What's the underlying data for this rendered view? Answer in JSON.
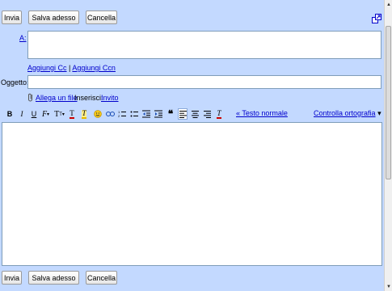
{
  "top_bar": {
    "send": "Invia",
    "save": "Salva adesso",
    "discard": "Cancella"
  },
  "bottom_bar": {
    "send": "Invia",
    "save": "Salva adesso",
    "discard": "Cancella"
  },
  "to": {
    "label": "A:",
    "value": ""
  },
  "recipients_links": {
    "add_cc": "Aggiungi Cc",
    "separator": "|",
    "add_bcc": "Aggiungi Ccn"
  },
  "subject": {
    "label": "Oggetto:",
    "value": ""
  },
  "attach": {
    "attach_file": "Allega un file",
    "insert_label": "Inserisci:",
    "invite": "Invito"
  },
  "toolbar": {
    "bold": "B",
    "italic": "I",
    "underline": "U",
    "plain_text_link": "« Testo normale",
    "spell_check": "Controlla ortografia",
    "spell_arrow": "▾"
  },
  "editor": {
    "body": ""
  },
  "colors": {
    "panel": "#c3d9ff",
    "link": "#0000cc",
    "field_border": "#7f9db9"
  }
}
